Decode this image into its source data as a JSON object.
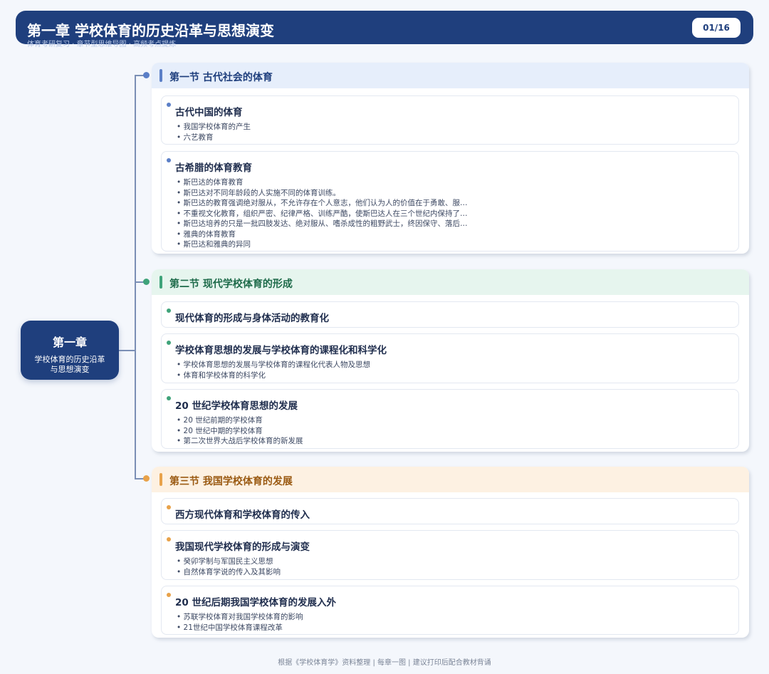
{
  "header": {
    "title": "第一章 学校体育的历史沿革与思想演变",
    "subtitle": "体育考研复习 · 章节型思维导图 · 高频考点提炼",
    "page": "01/16"
  },
  "root": {
    "title": "第一章",
    "subtitle_line1": "学校体育的历史沿革",
    "subtitle_line2": "与思想演变"
  },
  "colors": {
    "navy": "#1f3f7d",
    "section1_accent": "#5b7fc7",
    "section2_accent": "#3fa37a",
    "section3_accent": "#e8a24a"
  },
  "sections": [
    {
      "title": "第一节 古代社会的体育",
      "cards": [
        {
          "title": "古代中国的体育",
          "items": [
            "我国学校体育的产生",
            "六艺教育"
          ]
        },
        {
          "title": "古希腊的体育教育",
          "items": [
            "斯巴达的体育教育",
            "斯巴达对不同年龄段的人实施不同的体育训练。",
            "斯巴达的教育强调绝对服从，不允许存在个人意志，他们认为人的价值在于勇敢、服…",
            "不重视文化教育，组织严密、纪律严格、训练严酷，使斯巴达人在三个世纪内保持了…",
            "斯巴达培养的只是一批四肢发达、绝对服从、嗜杀成性的粗野武士，终因保守、落后…",
            "雅典的体育教育",
            "斯巴达和雅典的异同"
          ]
        }
      ]
    },
    {
      "title": "第二节 现代学校体育的形成",
      "cards": [
        {
          "title": "现代体育的形成与身体活动的教育化",
          "items": []
        },
        {
          "title": "学校体育思想的发展与学校体育的课程化和科学化",
          "items": [
            "学校体育思想的发展与学校体育的课程化代表人物及思想",
            "体育和学校体育的科学化"
          ]
        },
        {
          "title": "20 世纪学校体育思想的发展",
          "items": [
            "20 世纪前期的学校体育",
            "20 世纪中期的学校体育",
            "第二次世界大战后学校体育的新发展"
          ]
        }
      ]
    },
    {
      "title": "第三节 我国学校体育的发展",
      "cards": [
        {
          "title": "西方现代体育和学校体育的传入",
          "items": []
        },
        {
          "title": "我国现代学校体育的形成与演变",
          "items": [
            "癸卯学制与军国民主义思想",
            "自然体育学说的传入及其影响"
          ]
        },
        {
          "title": "20 世纪后期我国学校体育的发展入外",
          "items": [
            "苏联学校体育对我国学校体育的影响",
            "21世纪中国学校体育课程改革"
          ]
        }
      ]
    }
  ],
  "footer": "根据《学校体育学》资料整理 | 每章一图 | 建议打印后配合教材背诵"
}
